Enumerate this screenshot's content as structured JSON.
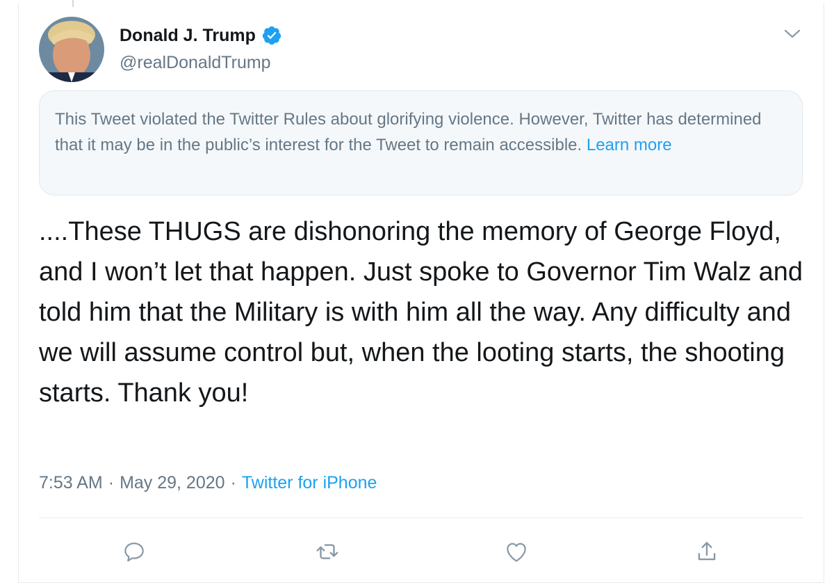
{
  "tweet": {
    "author_name": "Donald J. Trump",
    "handle": "@realDonaldTrump",
    "notice": {
      "text": "This Tweet violated the Twitter Rules about glorifying violence. However, Twitter has determined that it may be in the public’s interest for the Tweet to remain accessible.",
      "link_label": "Learn more"
    },
    "text": "....These THUGS are dishonoring the memory of George Floyd, and I won’t let that happen. Just spoke to Governor Tim Walz and told him that the Military is with him all the way. Any difficulty and we will assume control but, when the looting starts, the shooting starts. Thank you!",
    "time": "7:53 AM",
    "date": "May 29, 2020",
    "separator": "·",
    "source": "Twitter for iPhone"
  },
  "icons": {
    "verified": "verified-badge-icon",
    "caret": "chevron-down-icon",
    "reply": "reply-icon",
    "retweet": "retweet-icon",
    "like": "heart-icon",
    "share": "share-icon"
  },
  "colors": {
    "accent": "#1da1f2",
    "secondary_text": "#657786",
    "notice_bg": "#f5f8fa",
    "icon_gray": "#8899a6"
  }
}
